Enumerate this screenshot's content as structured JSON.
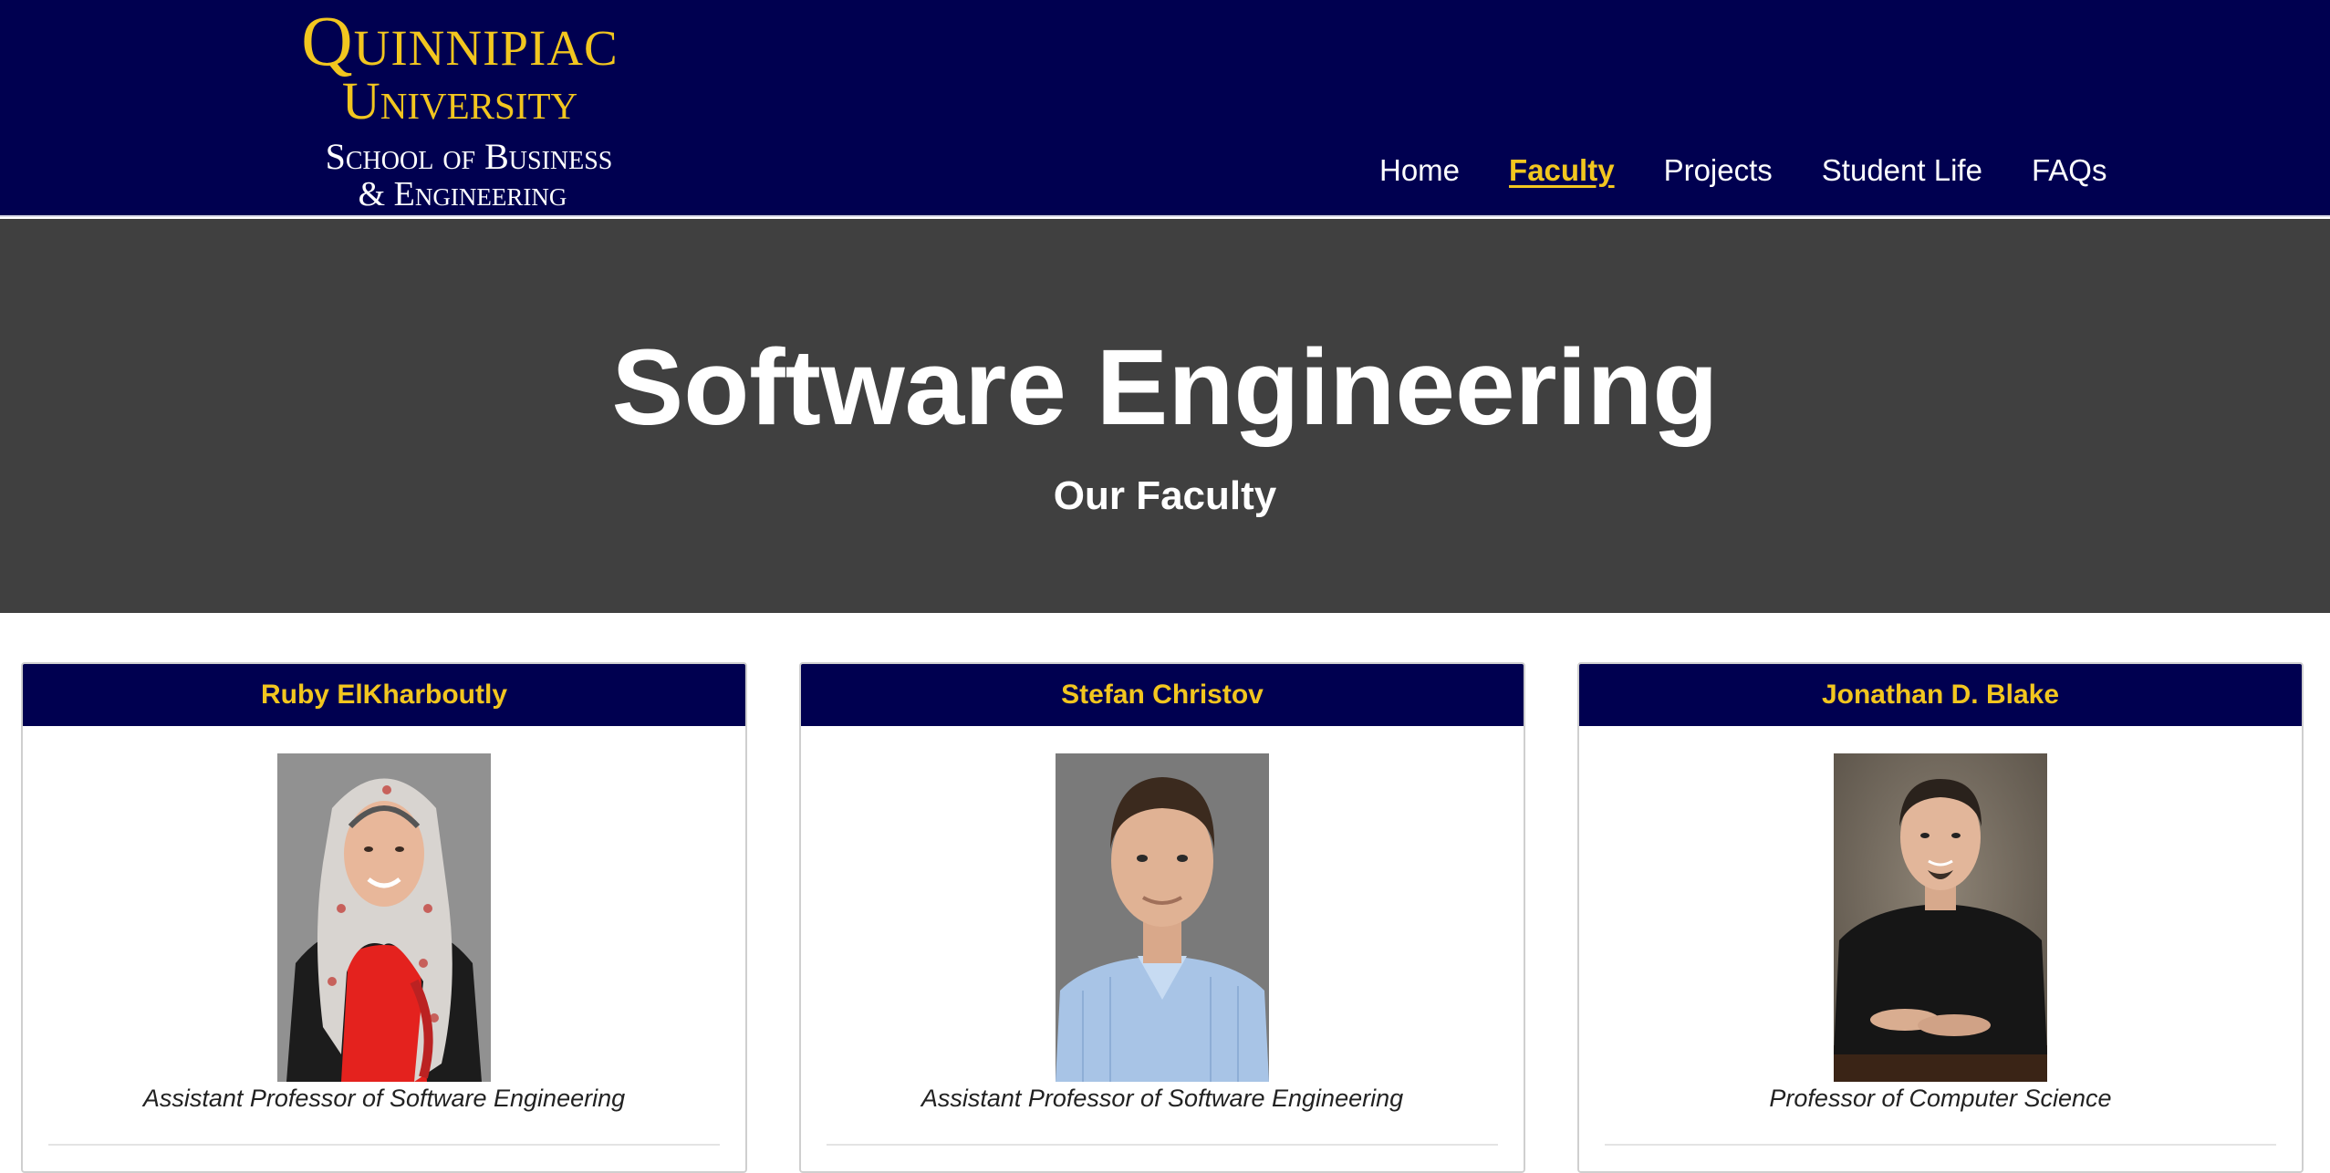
{
  "logo": {
    "line1": "Quinnipiac",
    "line2": "University",
    "line3": "School of Business",
    "line4": "& Engineering"
  },
  "nav": {
    "items": [
      {
        "label": "Home",
        "active": false
      },
      {
        "label": "Faculty",
        "active": true
      },
      {
        "label": "Projects",
        "active": false
      },
      {
        "label": "Student Life",
        "active": false
      },
      {
        "label": "FAQs",
        "active": false
      }
    ]
  },
  "hero": {
    "title": "Software Engineering",
    "subtitle": "Our Faculty"
  },
  "faculty": [
    {
      "name": "Ruby ElKharboutly",
      "title": "Assistant Professor of Software Engineering"
    },
    {
      "name": "Stefan Christov",
      "title": "Assistant Professor of Software Engineering"
    },
    {
      "name": "Jonathan D. Blake",
      "title": "Professor of Computer Science"
    }
  ],
  "colors": {
    "header_bg": "#000050",
    "accent_gold": "#f2c61f",
    "hero_bg": "#404040"
  }
}
